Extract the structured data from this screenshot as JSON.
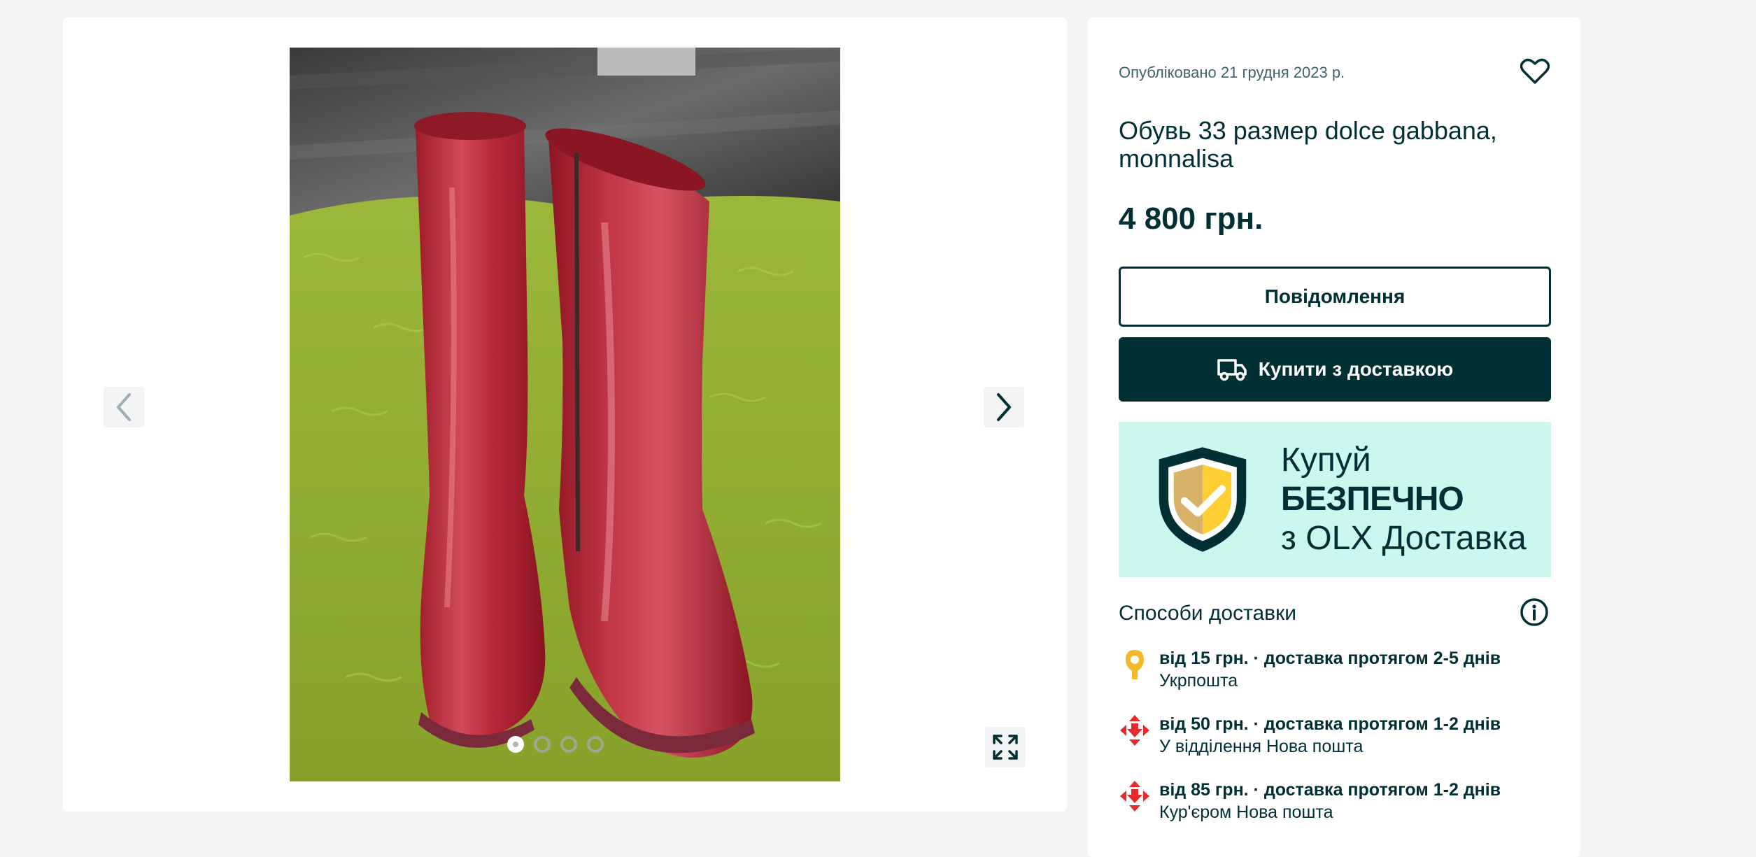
{
  "gallery": {
    "image_alt": "Червоні лаковані гумові чоботи на зеленому килимі",
    "dots": [
      {
        "active": true
      },
      {
        "active": false
      },
      {
        "active": false
      },
      {
        "active": false
      }
    ],
    "prev_icon": "chevron-left-icon",
    "next_icon": "chevron-right-icon",
    "expand_icon": "expand-icon"
  },
  "listing": {
    "published": "Опубліковано 21 грудня 2023 р.",
    "title": "Обувь 33 размер dolce gabbana, monnalisa",
    "price": "4 800 грн.",
    "message_button": "Повідомлення",
    "buy_button": "Купити з доставкою"
  },
  "banner": {
    "line1_prefix": "Купуй ",
    "line1_bold": "БЕЗПЕЧНО",
    "line2": "з OLX Доставка"
  },
  "delivery": {
    "title": "Способи доставки",
    "items": [
      {
        "main": "від 15 грн. · доставка протягом 2-5 днів",
        "sub": "Укрпошта",
        "icon": "ukrposhta-pin-icon"
      },
      {
        "main": "від 50 грн. · доставка протягом 1-2 днів",
        "sub": "У відділення Нова пошта",
        "icon": "nova-poshta-icon"
      },
      {
        "main": "від 85 грн. · доставка протягом 1-2 днів",
        "sub": "Кур'єром Нова пошта",
        "icon": "nova-poshta-icon"
      }
    ]
  },
  "colors": {
    "primary_dark": "#002f34",
    "banner_bg": "#cbf7ee",
    "shield_gold": "#ffce32",
    "nova_red": "#e52b2b",
    "ukrposhta_yellow": "#f5b82b"
  }
}
